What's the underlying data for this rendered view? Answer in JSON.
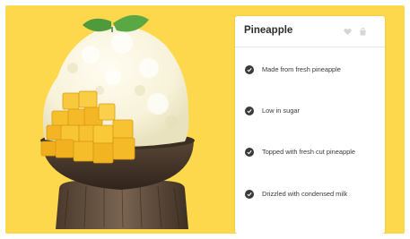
{
  "card": {
    "title": "Pineapple",
    "features": [
      "Made from fresh pineapple",
      "Low in sugar",
      "Topped with fresh cut pineapple",
      "Drizzled with condensed milk"
    ]
  },
  "icons": {
    "heart": "heart-icon",
    "bag": "shopping-bag-icon",
    "check": "check-circle-icon"
  },
  "colors": {
    "background": "#fdd84c",
    "card": "#ffffff",
    "text": "#2e2e2e",
    "icon_muted": "#d6d6d6"
  }
}
